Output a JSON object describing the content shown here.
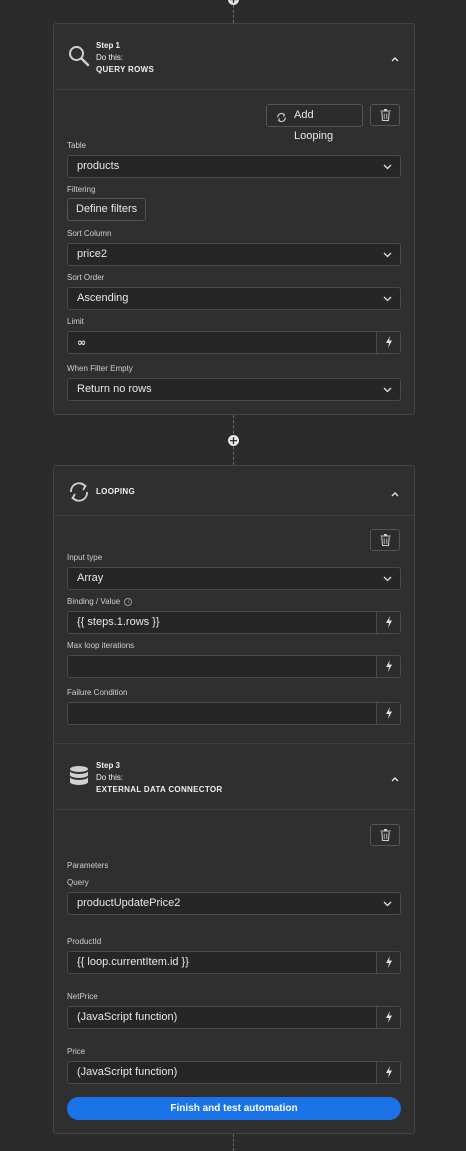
{
  "step1": {
    "step_label": "Step 1",
    "do_this": "Do this:",
    "name": "QUERY ROWS",
    "icon": "search-icon",
    "add_looping_label": "Add Looping",
    "table_label": "Table",
    "table_value": "products",
    "filtering_label": "Filtering",
    "define_filters_label": "Define filters",
    "sort_column_label": "Sort Column",
    "sort_column_value": "price2",
    "sort_order_label": "Sort Order",
    "sort_order_value": "Ascending",
    "limit_label": "Limit",
    "limit_value": "∞",
    "when_filter_empty_label": "When Filter Empty",
    "when_filter_empty_value": "Return no rows"
  },
  "looping": {
    "name": "LOOPING",
    "icon": "loop-icon",
    "input_type_label": "Input type",
    "input_type_value": "Array",
    "binding_label": "Binding / Value",
    "binding_value": "{{ steps.1.rows }}",
    "max_iterations_label": "Max loop iterations",
    "max_iterations_value": "",
    "failure_condition_label": "Failure Condition",
    "failure_condition_value": ""
  },
  "step3": {
    "step_label": "Step 3",
    "do_this": "Do this:",
    "name": "EXTERNAL DATA CONNECTOR",
    "icon": "database-icon",
    "parameters_label": "Parameters",
    "query_label": "Query",
    "query_value": "productUpdatePrice2",
    "product_id_label": "ProductId",
    "product_id_value": "{{ loop.currentItem.id }}",
    "net_price_label": "NetPrice",
    "net_price_value": "(JavaScript function)",
    "price_label": "Price",
    "price_value": "(JavaScript function)",
    "finish_button_label": "Finish and test automation"
  },
  "colors": {
    "background": "#2b2b2b",
    "card": "#2f2f2f",
    "primary": "#1a73e8"
  }
}
